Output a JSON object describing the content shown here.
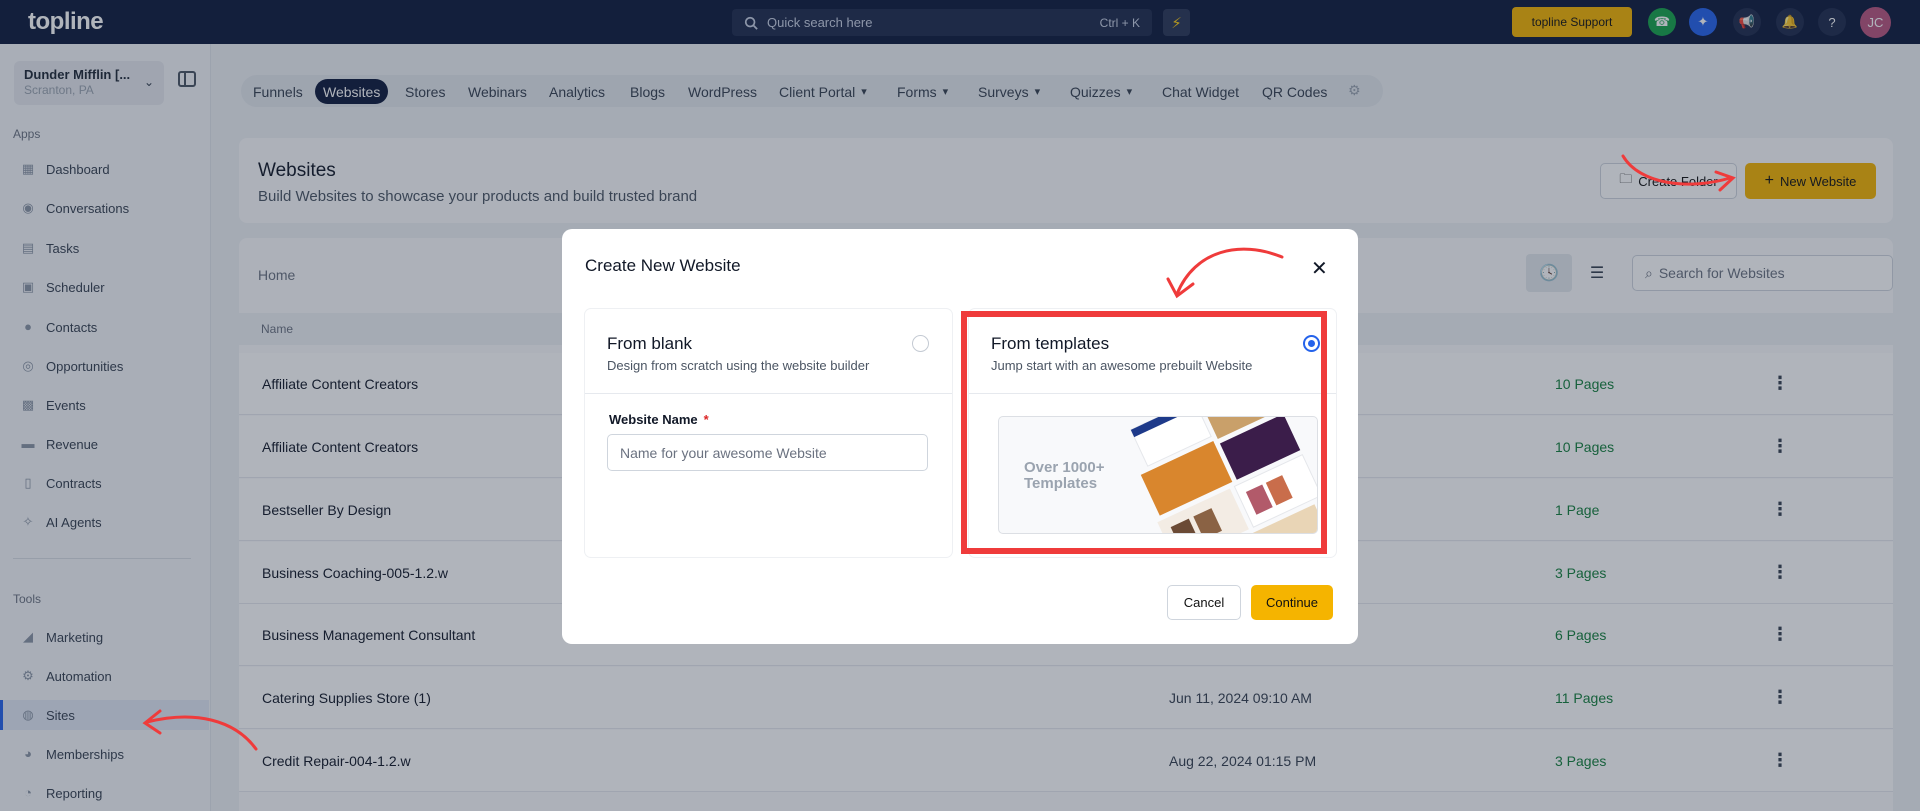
{
  "app": {
    "logo": "topline"
  },
  "topbar": {
    "search_placeholder": "Quick search here",
    "search_shortcut": "Ctrl + K",
    "support_label": "topline Support",
    "avatar_initials": "JC"
  },
  "sidebar": {
    "account_name": "Dunder Mifflin [...",
    "account_location": "Scranton, PA",
    "apps_label": "Apps",
    "tools_label": "Tools",
    "apps": [
      "Dashboard",
      "Conversations",
      "Tasks",
      "Scheduler",
      "Contacts",
      "Opportunities",
      "Events",
      "Revenue",
      "Contracts",
      "AI Agents"
    ],
    "tools": [
      "Marketing",
      "Automation",
      "Sites",
      "Memberships",
      "Reporting"
    ]
  },
  "tabs": [
    "Funnels",
    "Websites",
    "Stores",
    "Webinars",
    "Analytics",
    "Blogs",
    "WordPress",
    "Client Portal",
    "Forms",
    "Surveys",
    "Quizzes",
    "Chat Widget",
    "QR Codes"
  ],
  "header": {
    "title": "Websites",
    "subtitle": "Build Websites to showcase your products and build trusted brand",
    "create_folder": "Create Folder",
    "new_website": "New Website"
  },
  "list": {
    "breadcrumb": "Home",
    "search_placeholder": "Search for Websites",
    "column_name": "Name",
    "rows": [
      {
        "name": "Affiliate Content Creators",
        "date": "",
        "pages": "10 Pages"
      },
      {
        "name": "Affiliate Content Creators",
        "date": "",
        "pages": "10 Pages"
      },
      {
        "name": "Bestseller By Design",
        "date": "",
        "pages": "1 Page"
      },
      {
        "name": "Business Coaching-005-1.2.w",
        "date": "",
        "pages": "3 Pages"
      },
      {
        "name": "Business Management Consultant",
        "date": "",
        "pages": "6 Pages"
      },
      {
        "name": "Catering Supplies Store (1)",
        "date": "Jun 11, 2024 09:10 AM",
        "pages": "11 Pages"
      },
      {
        "name": "Credit Repair-004-1.2.w",
        "date": "Aug 22, 2024 01:15 PM",
        "pages": "3 Pages"
      }
    ]
  },
  "modal": {
    "title": "Create New Website",
    "blank_title": "From blank",
    "blank_desc": "Design from scratch using the website builder",
    "field_label": "Website Name",
    "field_required": "*",
    "field_placeholder": "Name for your awesome Website",
    "templates_title": "From templates",
    "templates_desc": "Jump start with an awesome prebuilt Website",
    "templates_banner": "Over 1000+ Templates",
    "selected_option": "From templates",
    "cancel": "Cancel",
    "continue": "Continue"
  },
  "colors": {
    "accent": "#f5b400",
    "topbar": "#0f1b3d",
    "highlight": "#ef3b3b",
    "link_green": "#15803d"
  }
}
